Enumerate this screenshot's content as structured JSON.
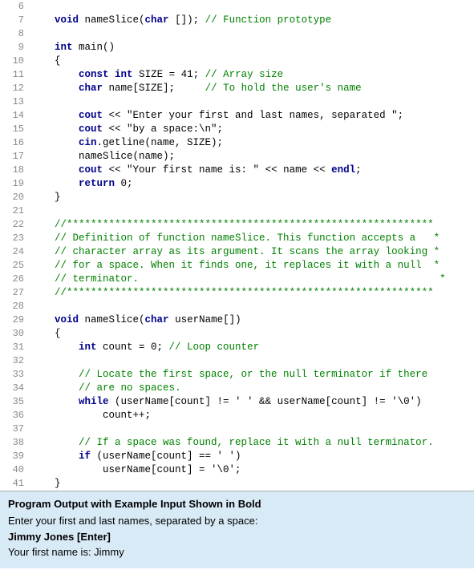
{
  "lines": [
    {
      "num": "6",
      "content": ""
    },
    {
      "num": "7",
      "content": "    void nameSlice(char []); // Function prototype"
    },
    {
      "num": "8",
      "content": ""
    },
    {
      "num": "9",
      "content": "    int main()"
    },
    {
      "num": "10",
      "content": "    {"
    },
    {
      "num": "11",
      "content": "        const int SIZE = 41; // Array size"
    },
    {
      "num": "12",
      "content": "        char name[SIZE];     // To hold the user's name"
    },
    {
      "num": "13",
      "content": ""
    },
    {
      "num": "14",
      "content": "        cout << \"Enter your first and last names, separated \";"
    },
    {
      "num": "15",
      "content": "        cout << \"by a space:\\n\";"
    },
    {
      "num": "16",
      "content": "        cin.getline(name, SIZE);"
    },
    {
      "num": "17",
      "content": "        nameSlice(name);"
    },
    {
      "num": "18",
      "content": "        cout << \"Your first name is: \" << name << endl;"
    },
    {
      "num": "19",
      "content": "        return 0;"
    },
    {
      "num": "20",
      "content": "    }"
    },
    {
      "num": "21",
      "content": ""
    },
    {
      "num": "22",
      "content": "    //*************************************************************"
    },
    {
      "num": "23",
      "content": "    // Definition of function nameSlice. This function accepts a   *"
    },
    {
      "num": "24",
      "content": "    // character array as its argument. It scans the array looking *"
    },
    {
      "num": "25",
      "content": "    // for a space. When it finds one, it replaces it with a null  *"
    },
    {
      "num": "26",
      "content": "    // terminator.                                                  *"
    },
    {
      "num": "27",
      "content": "    //*************************************************************"
    },
    {
      "num": "28",
      "content": ""
    },
    {
      "num": "29",
      "content": "    void nameSlice(char userName[])"
    },
    {
      "num": "30",
      "content": "    {"
    },
    {
      "num": "31",
      "content": "        int count = 0; // Loop counter"
    },
    {
      "num": "32",
      "content": ""
    },
    {
      "num": "33",
      "content": "        // Locate the first space, or the null terminator if there"
    },
    {
      "num": "34",
      "content": "        // are no spaces."
    },
    {
      "num": "35",
      "content": "        while (userName[count] != ' ' && userName[count] != '\\0')"
    },
    {
      "num": "36",
      "content": "            count++;"
    },
    {
      "num": "37",
      "content": ""
    },
    {
      "num": "38",
      "content": "        // If a space was found, replace it with a null terminator."
    },
    {
      "num": "39",
      "content": "        if (userName[count] == ' ')"
    },
    {
      "num": "40",
      "content": "            userName[count] = '\\0';"
    },
    {
      "num": "41",
      "content": "    }"
    }
  ],
  "output": {
    "title": "Program Output with Example Input Shown in Bold",
    "line1": "Enter your first and last names, separated by a space:",
    "line2": "Jimmy Jones [Enter]",
    "line3": "Your first name is: Jimmy"
  }
}
